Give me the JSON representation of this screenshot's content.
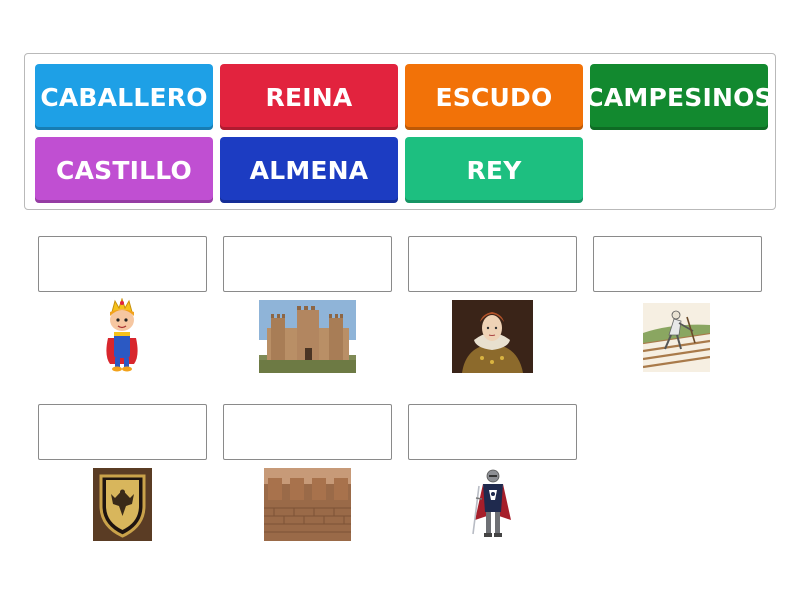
{
  "word_bank": {
    "tiles": [
      {
        "label": "CABALLERO",
        "color": "#1ea0e6"
      },
      {
        "label": "REINA",
        "color": "#e2233e"
      },
      {
        "label": "ESCUDO",
        "color": "#f27208"
      },
      {
        "label": "CAMPESINOS",
        "color": "#12892f"
      },
      {
        "label": "CASTILLO",
        "color": "#c04fd2"
      },
      {
        "label": "ALMENA",
        "color": "#1c3cc2"
      },
      {
        "label": "REY",
        "color": "#1dbf80"
      }
    ]
  },
  "match_slots": [
    {
      "value": "",
      "image": "cartoon-king-icon"
    },
    {
      "value": "",
      "image": "castle-photo-icon"
    },
    {
      "value": "",
      "image": "queen-portrait-icon"
    },
    {
      "value": "",
      "image": "peasant-farmer-icon"
    },
    {
      "value": "",
      "image": "heraldic-shield-icon"
    },
    {
      "value": "",
      "image": "battlement-wall-icon"
    },
    {
      "value": "",
      "image": "armored-knight-icon"
    }
  ]
}
